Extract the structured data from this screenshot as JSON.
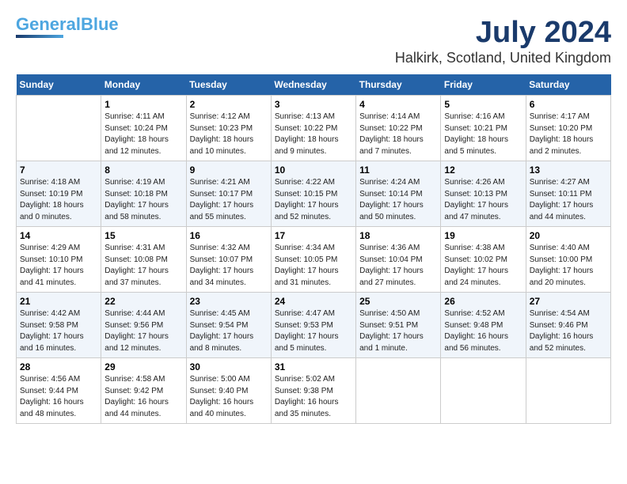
{
  "header": {
    "logo_line1": "General",
    "logo_line2": "Blue",
    "month": "July 2024",
    "location": "Halkirk, Scotland, United Kingdom"
  },
  "days_of_week": [
    "Sunday",
    "Monday",
    "Tuesday",
    "Wednesday",
    "Thursday",
    "Friday",
    "Saturday"
  ],
  "weeks": [
    [
      {
        "day": "",
        "info": ""
      },
      {
        "day": "1",
        "info": "Sunrise: 4:11 AM\nSunset: 10:24 PM\nDaylight: 18 hours\nand 12 minutes."
      },
      {
        "day": "2",
        "info": "Sunrise: 4:12 AM\nSunset: 10:23 PM\nDaylight: 18 hours\nand 10 minutes."
      },
      {
        "day": "3",
        "info": "Sunrise: 4:13 AM\nSunset: 10:22 PM\nDaylight: 18 hours\nand 9 minutes."
      },
      {
        "day": "4",
        "info": "Sunrise: 4:14 AM\nSunset: 10:22 PM\nDaylight: 18 hours\nand 7 minutes."
      },
      {
        "day": "5",
        "info": "Sunrise: 4:16 AM\nSunset: 10:21 PM\nDaylight: 18 hours\nand 5 minutes."
      },
      {
        "day": "6",
        "info": "Sunrise: 4:17 AM\nSunset: 10:20 PM\nDaylight: 18 hours\nand 2 minutes."
      }
    ],
    [
      {
        "day": "7",
        "info": "Sunrise: 4:18 AM\nSunset: 10:19 PM\nDaylight: 18 hours\nand 0 minutes."
      },
      {
        "day": "8",
        "info": "Sunrise: 4:19 AM\nSunset: 10:18 PM\nDaylight: 17 hours\nand 58 minutes."
      },
      {
        "day": "9",
        "info": "Sunrise: 4:21 AM\nSunset: 10:17 PM\nDaylight: 17 hours\nand 55 minutes."
      },
      {
        "day": "10",
        "info": "Sunrise: 4:22 AM\nSunset: 10:15 PM\nDaylight: 17 hours\nand 52 minutes."
      },
      {
        "day": "11",
        "info": "Sunrise: 4:24 AM\nSunset: 10:14 PM\nDaylight: 17 hours\nand 50 minutes."
      },
      {
        "day": "12",
        "info": "Sunrise: 4:26 AM\nSunset: 10:13 PM\nDaylight: 17 hours\nand 47 minutes."
      },
      {
        "day": "13",
        "info": "Sunrise: 4:27 AM\nSunset: 10:11 PM\nDaylight: 17 hours\nand 44 minutes."
      }
    ],
    [
      {
        "day": "14",
        "info": "Sunrise: 4:29 AM\nSunset: 10:10 PM\nDaylight: 17 hours\nand 41 minutes."
      },
      {
        "day": "15",
        "info": "Sunrise: 4:31 AM\nSunset: 10:08 PM\nDaylight: 17 hours\nand 37 minutes."
      },
      {
        "day": "16",
        "info": "Sunrise: 4:32 AM\nSunset: 10:07 PM\nDaylight: 17 hours\nand 34 minutes."
      },
      {
        "day": "17",
        "info": "Sunrise: 4:34 AM\nSunset: 10:05 PM\nDaylight: 17 hours\nand 31 minutes."
      },
      {
        "day": "18",
        "info": "Sunrise: 4:36 AM\nSunset: 10:04 PM\nDaylight: 17 hours\nand 27 minutes."
      },
      {
        "day": "19",
        "info": "Sunrise: 4:38 AM\nSunset: 10:02 PM\nDaylight: 17 hours\nand 24 minutes."
      },
      {
        "day": "20",
        "info": "Sunrise: 4:40 AM\nSunset: 10:00 PM\nDaylight: 17 hours\nand 20 minutes."
      }
    ],
    [
      {
        "day": "21",
        "info": "Sunrise: 4:42 AM\nSunset: 9:58 PM\nDaylight: 17 hours\nand 16 minutes."
      },
      {
        "day": "22",
        "info": "Sunrise: 4:44 AM\nSunset: 9:56 PM\nDaylight: 17 hours\nand 12 minutes."
      },
      {
        "day": "23",
        "info": "Sunrise: 4:45 AM\nSunset: 9:54 PM\nDaylight: 17 hours\nand 8 minutes."
      },
      {
        "day": "24",
        "info": "Sunrise: 4:47 AM\nSunset: 9:53 PM\nDaylight: 17 hours\nand 5 minutes."
      },
      {
        "day": "25",
        "info": "Sunrise: 4:50 AM\nSunset: 9:51 PM\nDaylight: 17 hours\nand 1 minute."
      },
      {
        "day": "26",
        "info": "Sunrise: 4:52 AM\nSunset: 9:48 PM\nDaylight: 16 hours\nand 56 minutes."
      },
      {
        "day": "27",
        "info": "Sunrise: 4:54 AM\nSunset: 9:46 PM\nDaylight: 16 hours\nand 52 minutes."
      }
    ],
    [
      {
        "day": "28",
        "info": "Sunrise: 4:56 AM\nSunset: 9:44 PM\nDaylight: 16 hours\nand 48 minutes."
      },
      {
        "day": "29",
        "info": "Sunrise: 4:58 AM\nSunset: 9:42 PM\nDaylight: 16 hours\nand 44 minutes."
      },
      {
        "day": "30",
        "info": "Sunrise: 5:00 AM\nSunset: 9:40 PM\nDaylight: 16 hours\nand 40 minutes."
      },
      {
        "day": "31",
        "info": "Sunrise: 5:02 AM\nSunset: 9:38 PM\nDaylight: 16 hours\nand 35 minutes."
      },
      {
        "day": "",
        "info": ""
      },
      {
        "day": "",
        "info": ""
      },
      {
        "day": "",
        "info": ""
      }
    ]
  ]
}
